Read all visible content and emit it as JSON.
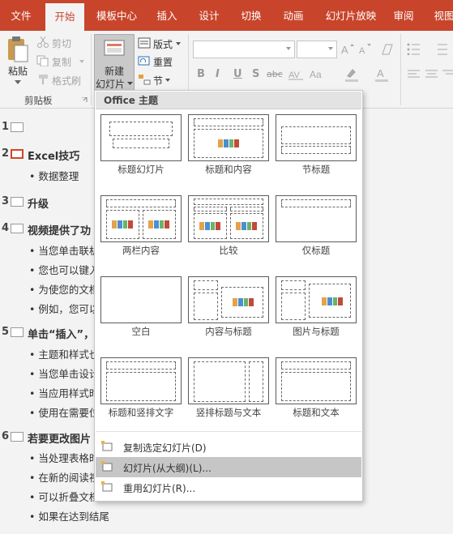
{
  "ribbon_tabs": [
    "文件",
    "开始",
    "模板中心",
    "插入",
    "设计",
    "切换",
    "动画",
    "幻灯片放映",
    "审阅",
    "视图"
  ],
  "active_tab": "开始",
  "clipboard": {
    "paste": "粘贴",
    "cut": "剪切",
    "copy": "复制",
    "format_painter": "格式刷",
    "group_label": "剪贴板"
  },
  "slides": {
    "new_slide_line1": "新建",
    "new_slide_line2": "幻灯片",
    "layout": "版式",
    "reset": "重置",
    "section": "节"
  },
  "font_format_letters": [
    "B",
    "I",
    "U",
    "S",
    "abc"
  ],
  "gallery": {
    "header": "Office 主题",
    "layouts": [
      {
        "name": "标题幻灯片"
      },
      {
        "name": "标题和内容"
      },
      {
        "name": "节标题"
      },
      {
        "name": "两栏内容"
      },
      {
        "name": "比较"
      },
      {
        "name": "仅标题"
      },
      {
        "name": "空白"
      },
      {
        "name": "内容与标题"
      },
      {
        "name": "图片与标题"
      },
      {
        "name": "标题和竖排文字"
      },
      {
        "name": "竖排标题与文本"
      },
      {
        "name": "标题和文本"
      }
    ],
    "menu": [
      {
        "label": "复制选定幻灯片(D)"
      },
      {
        "label": "幻灯片(从大纲)(L)..."
      },
      {
        "label": "重用幻灯片(R)..."
      }
    ],
    "highlighted_menu_index": 1
  },
  "outline": {
    "slides": [
      {
        "number": "1",
        "title": "",
        "bullets": []
      },
      {
        "number": "2",
        "title": "Excel技巧",
        "bullets": [
          "数据整理"
        ]
      },
      {
        "number": "3",
        "title": "升级",
        "bullets": []
      },
      {
        "number": "4",
        "title": "视频提供了功",
        "bullets": [
          "当您单击联机",
          "您也可以键入",
          "为使您的文档",
          "例如，您可以"
        ]
      },
      {
        "number": "5",
        "title": "单击“插入”，然",
        "bullets": [
          "主题和样式也",
          "当您单击设计",
          "当应用样式时",
          "使用在需要位"
        ]
      },
      {
        "number": "6",
        "title": "若要更改图片",
        "bullets": [
          "当处理表格时",
          "在新的阅读视",
          "可以折叠文档",
          "如果在达到结尾"
        ]
      }
    ],
    "selected_slide": "2"
  },
  "colors": {
    "accent": "#c8452b",
    "menu_highlight": "#c6c6c6"
  }
}
